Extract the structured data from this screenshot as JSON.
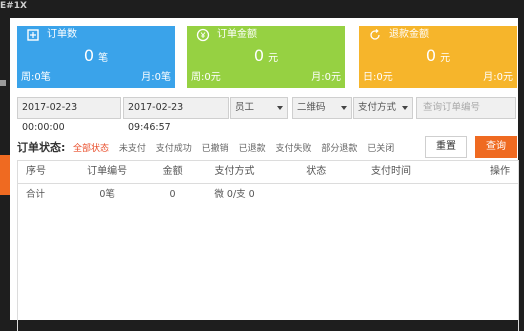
{
  "background": {
    "logo": "E#1X"
  },
  "cards": [
    {
      "title": "订单数",
      "value": "0",
      "unit": "笔",
      "left": "周:0笔",
      "right": "月:0笔",
      "icon": "receipt-icon"
    },
    {
      "title": "订单金额",
      "value": "0",
      "unit": "元",
      "left": "周:0元",
      "right": "月:0元",
      "icon": "yen-icon"
    },
    {
      "title": "退款金额",
      "value": "0",
      "unit": "元",
      "left": "日:0元",
      "right": "月:0元",
      "icon": "refund-icon"
    }
  ],
  "filters": {
    "start_date": "2017-02-23 00:00:00",
    "end_date": "2017-02-23 09:46:57",
    "employee": "员工",
    "qrcode": "二维码",
    "pay_method": "支付方式",
    "search_placeholder": "查询订单编号"
  },
  "status": {
    "label": "订单状态:",
    "options": [
      "全部状态",
      "未支付",
      "支付成功",
      "已撤销",
      "已退款",
      "支付失败",
      "部分退款",
      "已关闭"
    ],
    "active_index": 0
  },
  "buttons": {
    "reset": "重置",
    "query": "查询"
  },
  "table": {
    "headers": [
      "序号",
      "订单编号",
      "金额",
      "支付方式",
      "状态",
      "支付时间",
      "操作"
    ],
    "total_row": {
      "label": "合计",
      "count": "0笔",
      "amount": "0",
      "pay": "微 0/支 0"
    }
  },
  "colors": {
    "blue": "#3aa3ea",
    "green": "#96d142",
    "orange": "#f6b52b",
    "accent": "#ef6a21",
    "active_status": "#e94e2b"
  }
}
